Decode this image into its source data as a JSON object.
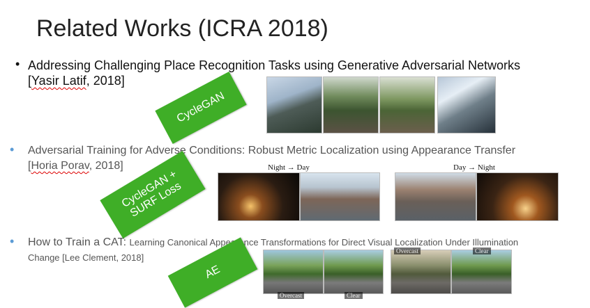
{
  "slide": {
    "title": "Related Works (ICRA 2018)",
    "items": [
      {
        "bullet": "•",
        "line1": "Addressing Challenging Place Recognition Tasks using Generative Adversarial Networks",
        "author_prefix": "[",
        "author_name": "Yasir Latif",
        "author_suffix": ", 2018]"
      },
      {
        "bullet": "•",
        "line1": "Adversarial Training for Adverse Conditions: Robust Metric Localization using Appearance Transfer",
        "author_prefix": "[",
        "author_name": "Horia Porav",
        "author_suffix": ", 2018]"
      },
      {
        "bullet": "•",
        "line1_lead": "How to Train a CAT: ",
        "line1_rest": "Learning Canonical Appearance Transformations for Direct Visual Localization Under Illumination",
        "line2": "Change [Lee Clement, 2018]"
      }
    ],
    "tags": {
      "tag1": "CycleGAN",
      "tag2_line1": "CycleGAN +",
      "tag2_line2": "SURF Loss",
      "tag3": "AE"
    },
    "captions": {
      "night_to_day": "Night → Day",
      "day_to_night": "Day → Night"
    },
    "overlay_labels": {
      "overcast_top": "Overcast",
      "clear_top": "Clear",
      "overcast_bottom": "Overcast",
      "clear_bottom": "Clear"
    },
    "colors": {
      "tag_green": "#3fae27",
      "title_text": "#222222",
      "sub_bullet_text": "#555555"
    }
  }
}
